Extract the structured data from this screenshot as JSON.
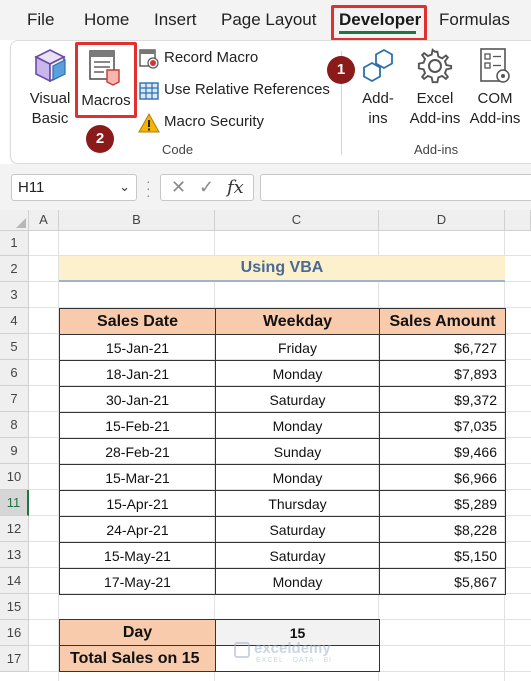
{
  "ribbon": {
    "tabs": [
      "File",
      "Home",
      "Insert",
      "Page Layout",
      "Developer",
      "Formulas"
    ],
    "active_tab": "Developer",
    "accent_color": "#217346",
    "highlight_color": "#e03030",
    "steps": [
      "1",
      "2"
    ],
    "code_group": {
      "label": "Code",
      "visual_basic_line1": "Visual",
      "visual_basic_line2": "Basic",
      "macros": "Macros",
      "record_macro": "Record Macro",
      "relative_refs": "Use Relative References",
      "macro_security": "Macro Security"
    },
    "addins_group": {
      "label": "Add-ins",
      "addins_line1": "Add-",
      "addins_line2": "ins",
      "excel_line1": "Excel",
      "excel_line2": "Add-ins",
      "com_line1": "COM",
      "com_line2": "Add-ins"
    }
  },
  "formula_bar": {
    "name_box": "H11",
    "cancel_symbol": "✕",
    "enter_symbol": "✓",
    "fx_symbol": "fx",
    "formula": ""
  },
  "grid": {
    "columns": [
      "A",
      "B",
      "C",
      "D"
    ],
    "rows": [
      "1",
      "2",
      "3",
      "4",
      "5",
      "6",
      "7",
      "8",
      "9",
      "10",
      "11",
      "12",
      "13",
      "14",
      "15",
      "16",
      "17"
    ],
    "selected_row": "11"
  },
  "sheet": {
    "title": "Using VBA",
    "headers": [
      "Sales Date",
      "Weekday",
      "Sales Amount"
    ],
    "rows": [
      [
        "15-Jan-21",
        "Friday",
        "$6,727"
      ],
      [
        "18-Jan-21",
        "Monday",
        "$7,893"
      ],
      [
        "30-Jan-21",
        "Saturday",
        "$9,372"
      ],
      [
        "15-Feb-21",
        "Monday",
        "$7,035"
      ],
      [
        "28-Feb-21",
        "Sunday",
        "$9,466"
      ],
      [
        "15-Mar-21",
        "Monday",
        "$6,966"
      ],
      [
        "15-Apr-21",
        "Thursday",
        "$5,289"
      ],
      [
        "24-Apr-21",
        "Saturday",
        "$8,228"
      ],
      [
        "15-May-21",
        "Saturday",
        "$5,150"
      ],
      [
        "17-May-21",
        "Monday",
        "$5,867"
      ]
    ],
    "day_label": "Day",
    "day_value": "15",
    "total_label": "Total Sales on 15",
    "total_value": ""
  },
  "watermark": {
    "name": "exceldemy",
    "tagline": "EXCEL · DATA · BI"
  }
}
